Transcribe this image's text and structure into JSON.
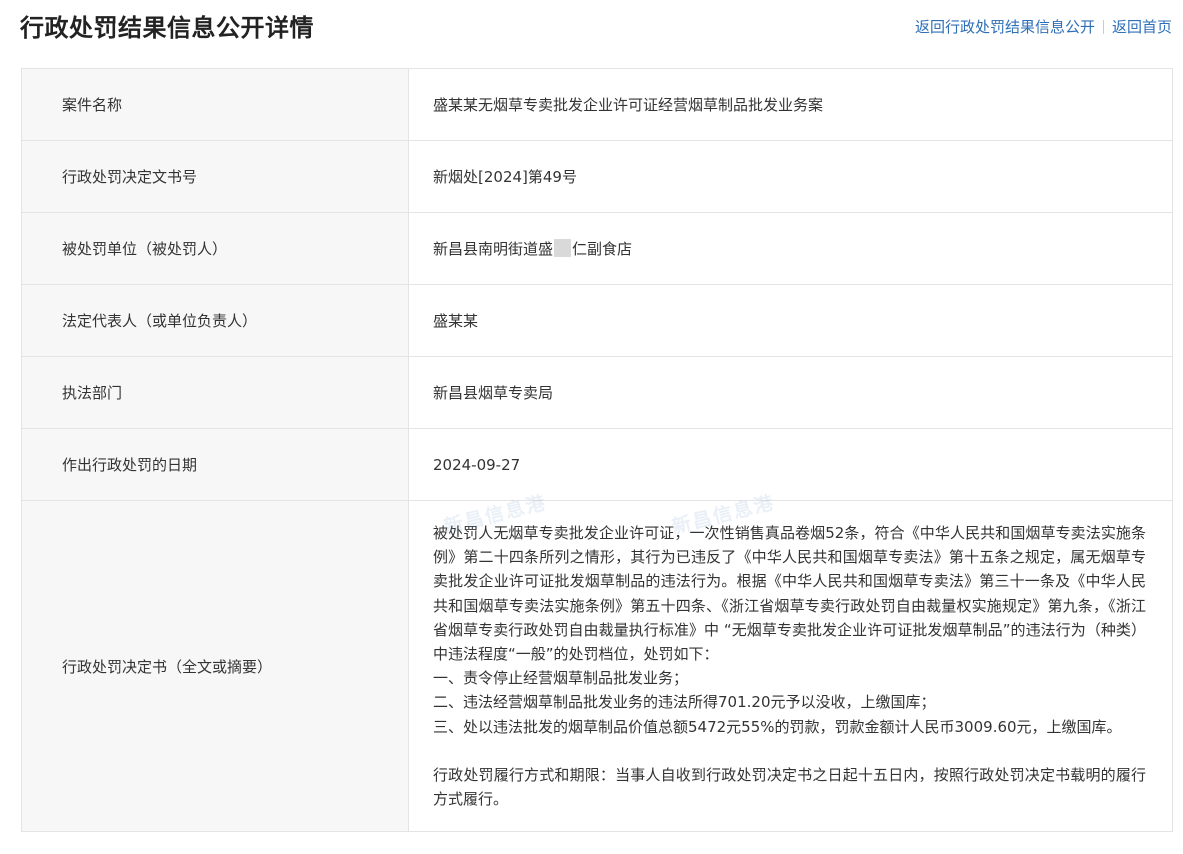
{
  "header": {
    "title": "行政处罚结果信息公开详情",
    "back_link": "返回行政处罚结果信息公开",
    "home_link": "返回首页"
  },
  "rows": [
    {
      "label": "案件名称",
      "value": "盛某某无烟草专卖批发企业许可证经营烟草制品批发业务案"
    },
    {
      "label": "行政处罚决定文书号",
      "value": "新烟处[2024]第49号"
    },
    {
      "label": "被处罚单位（被处罚人）",
      "value_before": "新昌县南明街道盛",
      "value_after": "仁副食店"
    },
    {
      "label": "法定代表人（或单位负责人）",
      "value": "盛某某"
    },
    {
      "label": "执法部门",
      "value": "新昌县烟草专卖局"
    },
    {
      "label": "作出行政处罚的日期",
      "value": "2024-09-27"
    }
  ],
  "decision": {
    "label": "行政处罚决定书（全文或摘要）",
    "paragraph": "被处罚人无烟草专卖批发企业许可证，一次性销售真品卷烟52条，符合《中华人民共和国烟草专卖法实施条例》第二十四条所列之情形，其行为已违反了《中华人民共和国烟草专卖法》第十五条之规定，属无烟草专卖批发企业许可证批发烟草制品的违法行为。根据《中华人民共和国烟草专卖法》第三十一条及《中华人民共和国烟草专卖法实施条例》第五十四条、《浙江省烟草专卖行政处罚自由裁量权实施规定》第九条，《浙江省烟草专卖行政处罚自由裁量执行标准》中 “无烟草专卖批发企业许可证批发烟草制品”的违法行为（种类）中违法程度“一般”的处罚档位，处罚如下：",
    "items": [
      "一、责令停止经营烟草制品批发业务；",
      "二、违法经营烟草制品批发业务的违法所得701.20元予以没收，上缴国库；",
      "三、处以违法批发的烟草制品价值总额5472元55%的罚款，罚款金额计人民币3009.60元，上缴国库。"
    ],
    "performance": "行政处罚履行方式和期限：当事人自收到行政处罚决定书之日起十五日内，按照行政处罚决定书载明的履行方式履行。"
  },
  "watermark": {
    "text": "新昌信息港"
  }
}
